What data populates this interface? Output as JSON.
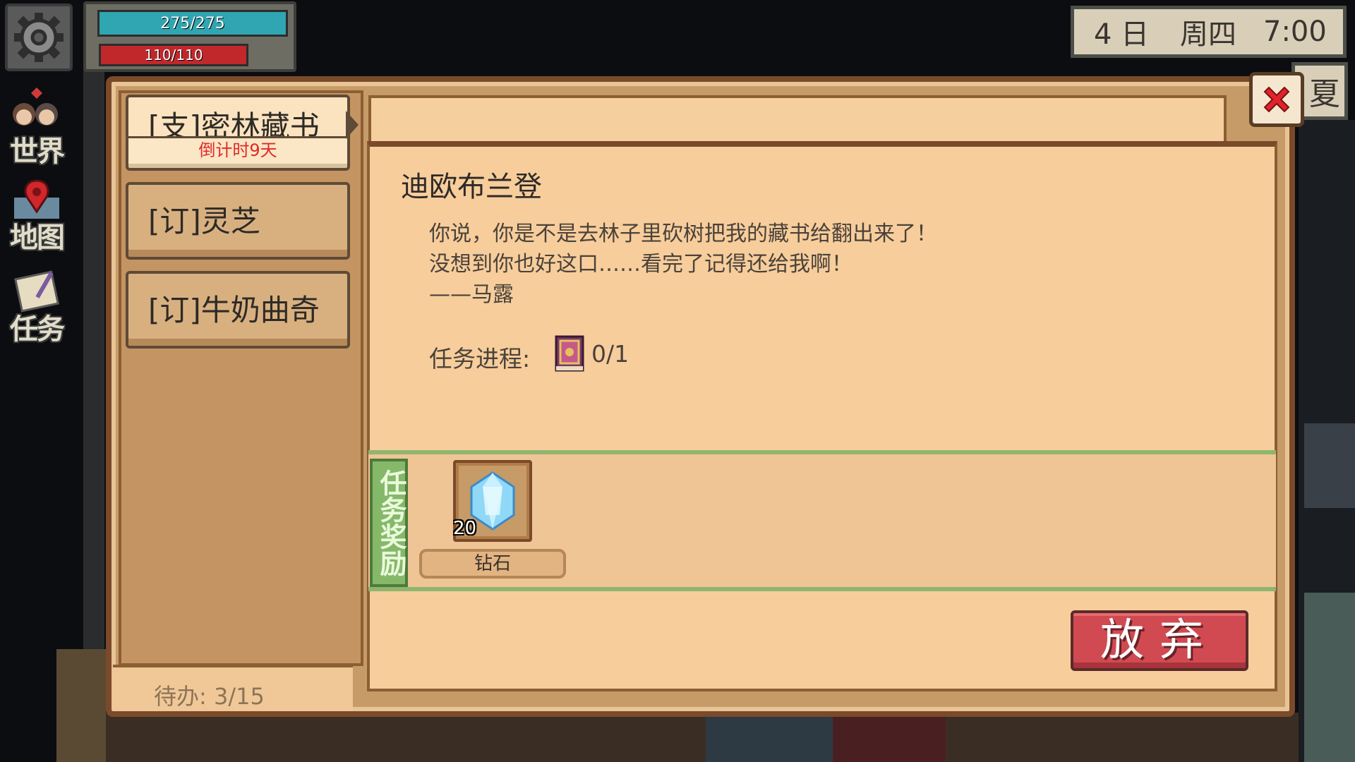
{
  "hud": {
    "hp": "275/275",
    "mp": "110/110",
    "date_day": "4 日",
    "date_weekday": "周四",
    "date_time": "7:00",
    "season": "夏"
  },
  "sidebar": {
    "items": [
      {
        "label": "世界",
        "icon": "world-icon"
      },
      {
        "label": "地图",
        "icon": "map-pin-icon"
      },
      {
        "label": "任务",
        "icon": "quest-scroll-icon"
      }
    ]
  },
  "quest_list": {
    "items": [
      {
        "title": "[支]密林藏书",
        "subtitle": "倒计时9天",
        "active": true
      },
      {
        "title": "[订]灵芝",
        "active": false
      },
      {
        "title": "[订]牛奶曲奇",
        "active": false
      }
    ],
    "pending": "待办:  3/15"
  },
  "quest_detail": {
    "npc": "迪欧布兰登",
    "description": [
      "你说，你是不是去林子里砍树把我的藏书给翻出来了！",
      "没想到你也好这口……看完了记得还给我啊！",
      "——马露"
    ],
    "progress_label": "任务进程:",
    "progress_item_icon": "book-icon",
    "progress_value": "0/1",
    "reward_tag": "任务奖励",
    "reward": {
      "name": "钻石",
      "count": "20",
      "icon": "diamond-icon"
    },
    "abandon_label": "放弃"
  },
  "colors": {
    "panel": "#f7cd9c",
    "frame": "#7a4a2a",
    "abandon": "#d14a52",
    "reward_tag": "#86b86a",
    "countdown": "#e02a2a"
  }
}
